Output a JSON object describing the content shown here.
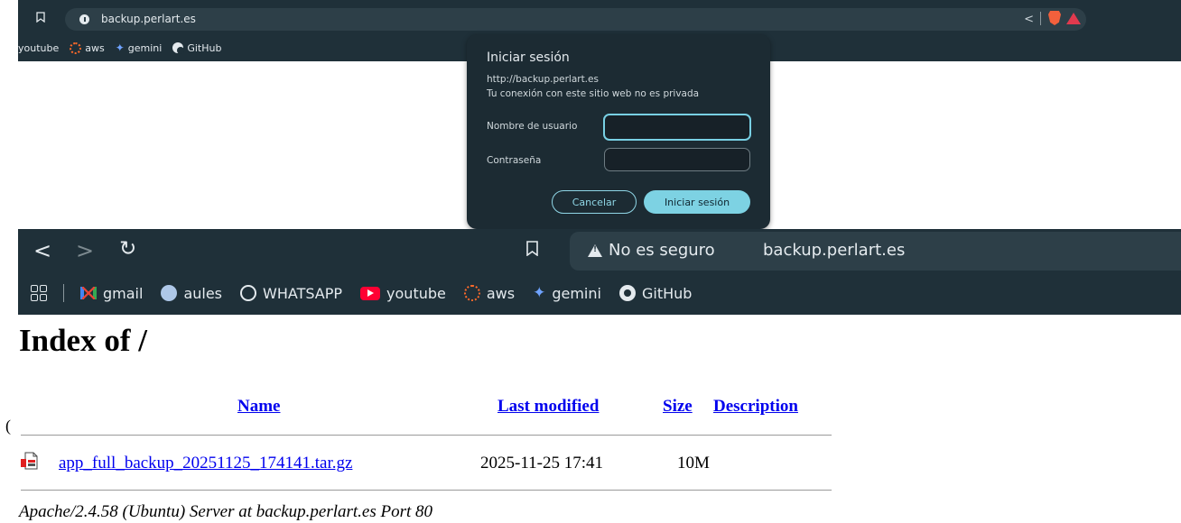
{
  "top_browser": {
    "url": "backup.perlart.es",
    "bookmarks": [
      {
        "label": "youtube",
        "icon": "youtube-icon"
      },
      {
        "label": "aws",
        "icon": "aws-icon"
      },
      {
        "label": "gemini",
        "icon": "gemini-icon"
      },
      {
        "label": "GitHub",
        "icon": "github-icon"
      }
    ]
  },
  "login_dialog": {
    "title": "Iniciar sesión",
    "url": "http://backup.perlart.es",
    "privacy_note": "Tu conexión con este sitio web no es privada",
    "username_label": "Nombre de usuario",
    "username_value": "",
    "password_label": "Contraseña",
    "password_value": "",
    "cancel_label": "Cancelar",
    "submit_label": "Iniciar sesión"
  },
  "browser": {
    "security_label": "No es seguro",
    "url": "backup.perlart.es",
    "bookmarks": [
      {
        "label": "gmail",
        "icon": "gmail-icon"
      },
      {
        "label": "aules",
        "icon": "aules-icon"
      },
      {
        "label": "WHATSAPP",
        "icon": "whatsapp-icon"
      },
      {
        "label": "youtube",
        "icon": "youtube-icon"
      },
      {
        "label": "aws",
        "icon": "aws-icon"
      },
      {
        "label": "gemini",
        "icon": "gemini-icon"
      },
      {
        "label": "GitHub",
        "icon": "github-icon"
      }
    ]
  },
  "listing": {
    "title": "Index of /",
    "columns": {
      "name": "Name",
      "last_modified": "Last modified",
      "size": "Size",
      "description": "Description"
    },
    "stray_char": "(",
    "files": [
      {
        "name": "app_full_backup_20251125_174141.tar.gz",
        "last_modified": "2025-11-25 17:41",
        "size": "10M",
        "description": ""
      }
    ],
    "server_signature": "Apache/2.4.58 (Ubuntu) Server at backup.perlart.es Port 80"
  },
  "colors": {
    "chrome_bg": "#1f3039",
    "dialog_bg": "#1c2b33",
    "accent": "#7dd2e3",
    "link": "#0000ee"
  }
}
